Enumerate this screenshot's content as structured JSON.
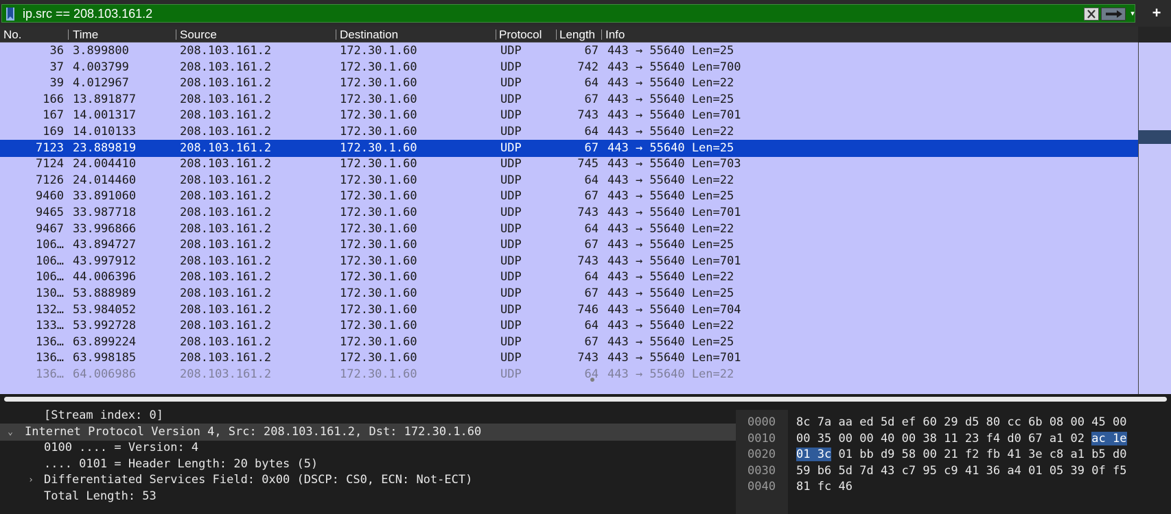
{
  "filter": {
    "text": "ip.src == 208.103.161.2",
    "bookmark_icon": "bookmark-icon",
    "clear_icon": "clear-filter-icon",
    "apply_icon": "apply-filter-arrow-icon",
    "dropdown_icon": "chevron-down-icon",
    "add_icon": "plus-icon",
    "bg_color": "#0b6e0b"
  },
  "columns": [
    "No.",
    "Time",
    "Source",
    "Destination",
    "Protocol",
    "Length",
    "Info"
  ],
  "packets": [
    {
      "no": "36",
      "time": "3.899800",
      "src": "208.103.161.2",
      "dst": "172.30.1.60",
      "proto": "UDP",
      "len": "67",
      "info": "443 → 55640 Len=25"
    },
    {
      "no": "37",
      "time": "4.003799",
      "src": "208.103.161.2",
      "dst": "172.30.1.60",
      "proto": "UDP",
      "len": "742",
      "info": "443 → 55640 Len=700"
    },
    {
      "no": "39",
      "time": "4.012967",
      "src": "208.103.161.2",
      "dst": "172.30.1.60",
      "proto": "UDP",
      "len": "64",
      "info": "443 → 55640 Len=22"
    },
    {
      "no": "166",
      "time": "13.891877",
      "src": "208.103.161.2",
      "dst": "172.30.1.60",
      "proto": "UDP",
      "len": "67",
      "info": "443 → 55640 Len=25"
    },
    {
      "no": "167",
      "time": "14.001317",
      "src": "208.103.161.2",
      "dst": "172.30.1.60",
      "proto": "UDP",
      "len": "743",
      "info": "443 → 55640 Len=701"
    },
    {
      "no": "169",
      "time": "14.010133",
      "src": "208.103.161.2",
      "dst": "172.30.1.60",
      "proto": "UDP",
      "len": "64",
      "info": "443 → 55640 Len=22"
    },
    {
      "no": "7123",
      "time": "23.889819",
      "src": "208.103.161.2",
      "dst": "172.30.1.60",
      "proto": "UDP",
      "len": "67",
      "info": "443 → 55640 Len=25",
      "selected": true
    },
    {
      "no": "7124",
      "time": "24.004410",
      "src": "208.103.161.2",
      "dst": "172.30.1.60",
      "proto": "UDP",
      "len": "745",
      "info": "443 → 55640 Len=703"
    },
    {
      "no": "7126",
      "time": "24.014460",
      "src": "208.103.161.2",
      "dst": "172.30.1.60",
      "proto": "UDP",
      "len": "64",
      "info": "443 → 55640 Len=22"
    },
    {
      "no": "9460",
      "time": "33.891060",
      "src": "208.103.161.2",
      "dst": "172.30.1.60",
      "proto": "UDP",
      "len": "67",
      "info": "443 → 55640 Len=25"
    },
    {
      "no": "9465",
      "time": "33.987718",
      "src": "208.103.161.2",
      "dst": "172.30.1.60",
      "proto": "UDP",
      "len": "743",
      "info": "443 → 55640 Len=701"
    },
    {
      "no": "9467",
      "time": "33.996866",
      "src": "208.103.161.2",
      "dst": "172.30.1.60",
      "proto": "UDP",
      "len": "64",
      "info": "443 → 55640 Len=22"
    },
    {
      "no": "106…",
      "time": "43.894727",
      "src": "208.103.161.2",
      "dst": "172.30.1.60",
      "proto": "UDP",
      "len": "67",
      "info": "443 → 55640 Len=25"
    },
    {
      "no": "106…",
      "time": "43.997912",
      "src": "208.103.161.2",
      "dst": "172.30.1.60",
      "proto": "UDP",
      "len": "743",
      "info": "443 → 55640 Len=701"
    },
    {
      "no": "106…",
      "time": "44.006396",
      "src": "208.103.161.2",
      "dst": "172.30.1.60",
      "proto": "UDP",
      "len": "64",
      "info": "443 → 55640 Len=22"
    },
    {
      "no": "130…",
      "time": "53.888989",
      "src": "208.103.161.2",
      "dst": "172.30.1.60",
      "proto": "UDP",
      "len": "67",
      "info": "443 → 55640 Len=25"
    },
    {
      "no": "132…",
      "time": "53.984052",
      "src": "208.103.161.2",
      "dst": "172.30.1.60",
      "proto": "UDP",
      "len": "746",
      "info": "443 → 55640 Len=704"
    },
    {
      "no": "133…",
      "time": "53.992728",
      "src": "208.103.161.2",
      "dst": "172.30.1.60",
      "proto": "UDP",
      "len": "64",
      "info": "443 → 55640 Len=22"
    },
    {
      "no": "136…",
      "time": "63.899224",
      "src": "208.103.161.2",
      "dst": "172.30.1.60",
      "proto": "UDP",
      "len": "67",
      "info": "443 → 55640 Len=25"
    },
    {
      "no": "136…",
      "time": "63.998185",
      "src": "208.103.161.2",
      "dst": "172.30.1.60",
      "proto": "UDP",
      "len": "743",
      "info": "443 → 55640 Len=701"
    },
    {
      "no": "136…",
      "time": "64.006986",
      "src": "208.103.161.2",
      "dst": "172.30.1.60",
      "proto": "UDP",
      "len": "64",
      "info": "443 → 55640 Len=22",
      "partial": true
    }
  ],
  "details": [
    {
      "text": "[Stream index: 0]",
      "indent": 2,
      "arrow": ""
    },
    {
      "text": "Internet Protocol Version 4, Src: 208.103.161.2, Dst: 172.30.1.60",
      "indent": 1,
      "arrow": "⌄",
      "highlight": true
    },
    {
      "text": "0100 .... = Version: 4",
      "indent": 2,
      "arrow": ""
    },
    {
      "text": ".... 0101 = Header Length: 20 bytes (5)",
      "indent": 2,
      "arrow": ""
    },
    {
      "text": "Differentiated Services Field: 0x00 (DSCP: CS0, ECN: Not-ECT)",
      "indent": 2,
      "arrow": "›"
    },
    {
      "text": "Total Length: 53",
      "indent": 2,
      "arrow": ""
    }
  ],
  "bytes": [
    {
      "offset": "0000",
      "hex": [
        "8c",
        "7a",
        "aa",
        "ed",
        "5d",
        "ef",
        "60",
        "29",
        "d5",
        "80",
        "cc",
        "6b",
        "08",
        "00",
        "45",
        "00"
      ]
    },
    {
      "offset": "0010",
      "hex": [
        "00",
        "35",
        "00",
        "00",
        "40",
        "00",
        "38",
        "11",
        "23",
        "f4",
        "d0",
        "67",
        "a1",
        "02",
        "ac",
        "1e"
      ],
      "sel_from": 14
    },
    {
      "offset": "0020",
      "hex": [
        "01",
        "3c",
        "01",
        "bb",
        "d9",
        "58",
        "00",
        "21",
        "f2",
        "fb",
        "41",
        "3e",
        "c8",
        "a1",
        "b5",
        "d0"
      ],
      "sel_to": 1
    },
    {
      "offset": "0030",
      "hex": [
        "59",
        "b6",
        "5d",
        "7d",
        "43",
        "c7",
        "95",
        "c9",
        "41",
        "36",
        "a4",
        "01",
        "05",
        "39",
        "0f",
        "f5"
      ]
    },
    {
      "offset": "0040",
      "hex": [
        "81",
        "fc",
        "46"
      ]
    }
  ],
  "colors": {
    "row_bg": "#c2c2fc",
    "selected_row": "#0c42c8",
    "byte_highlight": "#2f5b9a"
  }
}
